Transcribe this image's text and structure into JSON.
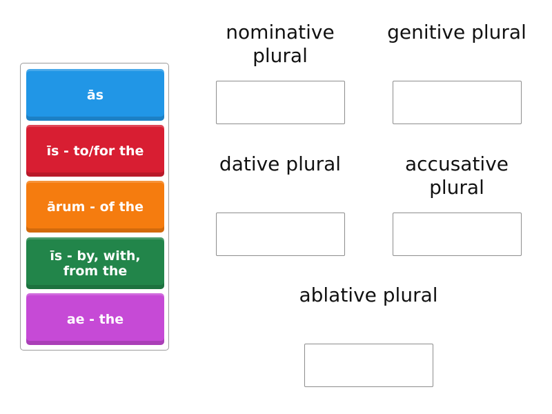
{
  "cards": [
    {
      "label": "ās",
      "color": "#2196e6"
    },
    {
      "label": "īs - to/for the",
      "color": "#d81e32"
    },
    {
      "label": "ārum - of the",
      "color": "#f57c0f"
    },
    {
      "label": "īs - by, with, from the",
      "color": "#22854a"
    },
    {
      "label": "ae - the",
      "color": "#c64ad6"
    }
  ],
  "targets": [
    {
      "label": "nominative plural",
      "value": ""
    },
    {
      "label": "genitive plural",
      "value": ""
    },
    {
      "label": "dative plural",
      "value": ""
    },
    {
      "label": "accusative plural",
      "value": ""
    },
    {
      "label": "ablative plural",
      "value": ""
    }
  ]
}
